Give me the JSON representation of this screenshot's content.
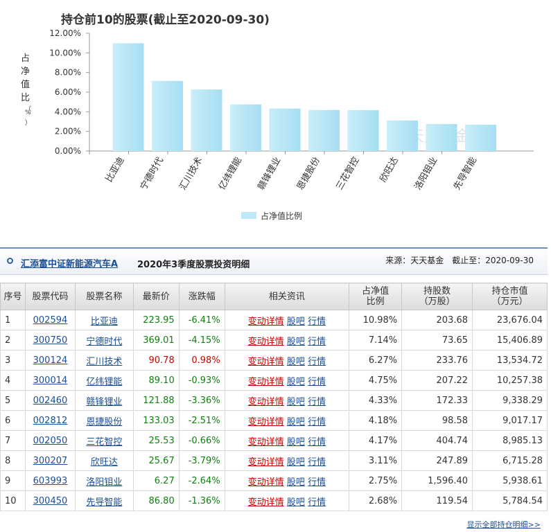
{
  "chart_data": {
    "type": "bar",
    "title": "持仓前10的股票(截止至2020-09-30)",
    "ylabel": "占净值比（%）",
    "categories": [
      "比亚迪",
      "宁德时代",
      "汇川技术",
      "亿纬锂能",
      "赣锋锂业",
      "恩捷股份",
      "三花智控",
      "欣旺达",
      "洛阳钼业",
      "先导智能"
    ],
    "series": [
      {
        "name": "占净值比例",
        "values": [
          10.98,
          7.14,
          6.27,
          4.75,
          4.33,
          4.18,
          4.17,
          3.11,
          2.75,
          2.68
        ]
      }
    ],
    "yticks": [
      "0.00%",
      "2.00%",
      "4.00%",
      "6.00%",
      "8.00%",
      "10.00%",
      "12.00%"
    ],
    "ylim": [
      0,
      12
    ],
    "grid": false,
    "legend": "bottom",
    "watermark": "天天基金网"
  },
  "header": {
    "fund_name": "汇添富中证新能源汽车A",
    "subtitle": "2020年3季度股票投资明细",
    "source": "来源：天天基金　截止至：2020-09-30"
  },
  "table": {
    "columns": [
      "序号",
      "股票代码",
      "股票名称",
      "最新价",
      "涨跌幅",
      "相关资讯",
      "占净值\n比例",
      "持股数\n（万股）",
      "持仓市值\n（万元）"
    ],
    "link_labels": {
      "detail": "变动详情",
      "bar": "股吧",
      "quote": "行情"
    },
    "rows": [
      {
        "no": "1",
        "code": "002594",
        "name": "比亚迪",
        "price": "223.95",
        "change": "-6.41%",
        "dir": "down",
        "ratio": "10.98%",
        "shares": "203.68",
        "value": "23,676.04"
      },
      {
        "no": "2",
        "code": "300750",
        "name": "宁德时代",
        "price": "369.01",
        "change": "-4.15%",
        "dir": "down",
        "ratio": "7.14%",
        "shares": "73.65",
        "value": "15,406.89"
      },
      {
        "no": "3",
        "code": "300124",
        "name": "汇川技术",
        "price": "90.78",
        "change": "0.98%",
        "dir": "up",
        "ratio": "6.27%",
        "shares": "233.76",
        "value": "13,534.72"
      },
      {
        "no": "4",
        "code": "300014",
        "name": "亿纬锂能",
        "price": "89.10",
        "change": "-0.93%",
        "dir": "down",
        "ratio": "4.75%",
        "shares": "207.22",
        "value": "10,257.38"
      },
      {
        "no": "5",
        "code": "002460",
        "name": "赣锋锂业",
        "price": "121.88",
        "change": "-3.36%",
        "dir": "down",
        "ratio": "4.33%",
        "shares": "172.33",
        "value": "9,338.29"
      },
      {
        "no": "6",
        "code": "002812",
        "name": "恩捷股份",
        "price": "133.03",
        "change": "-2.51%",
        "dir": "down",
        "ratio": "4.18%",
        "shares": "98.58",
        "value": "9,017.17"
      },
      {
        "no": "7",
        "code": "002050",
        "name": "三花智控",
        "price": "25.53",
        "change": "-0.66%",
        "dir": "down",
        "ratio": "4.17%",
        "shares": "404.74",
        "value": "8,985.13"
      },
      {
        "no": "8",
        "code": "300207",
        "name": "欣旺达",
        "price": "25.67",
        "change": "-3.79%",
        "dir": "down",
        "ratio": "3.11%",
        "shares": "247.89",
        "value": "6,715.28"
      },
      {
        "no": "9",
        "code": "603993",
        "name": "洛阳钼业",
        "price": "6.27",
        "change": "-2.64%",
        "dir": "down",
        "ratio": "2.75%",
        "shares": "1,596.40",
        "value": "5,938.61"
      },
      {
        "no": "10",
        "code": "300450",
        "name": "先导智能",
        "price": "86.80",
        "change": "-1.36%",
        "dir": "down",
        "ratio": "2.68%",
        "shares": "119.54",
        "value": "5,784.54"
      }
    ],
    "more_link": "显示全部持仓明细>>"
  },
  "colors": {
    "accent": "#1a4e96",
    "bar_top": "#c8eef8",
    "bar_side": "#a6def3",
    "down": "#108010",
    "up": "#cc0000"
  }
}
